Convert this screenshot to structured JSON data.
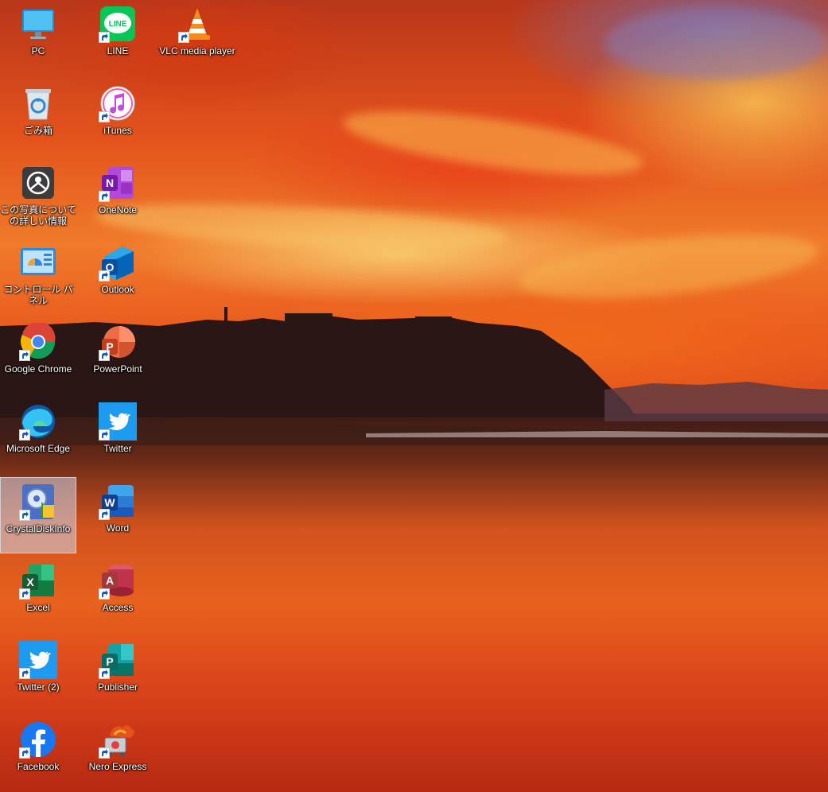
{
  "desktop": {
    "icons": [
      {
        "label": "PC",
        "icon": "monitor-icon",
        "name": "desktop-icon-pc",
        "shortcut": false
      },
      {
        "label": "LINE",
        "icon": "line-app-icon",
        "name": "desktop-icon-line",
        "shortcut": true
      },
      {
        "label": "VLC media player",
        "icon": "vlc-cone-icon",
        "name": "desktop-icon-vlc",
        "shortcut": true
      },
      {
        "label": "ごみ箱",
        "icon": "recycle-bin-icon",
        "name": "desktop-icon-recycle-bin",
        "shortcut": false
      },
      {
        "label": "iTunes",
        "icon": "itunes-icon",
        "name": "desktop-icon-itunes",
        "shortcut": true
      },
      {
        "label": "この写真について の詳しい情報",
        "icon": "photo-info-icon",
        "name": "desktop-icon-photo-info",
        "shortcut": false
      },
      {
        "label": "OneNote",
        "icon": "onenote-icon",
        "name": "desktop-icon-onenote",
        "shortcut": true
      },
      {
        "label": "コントロール パネル",
        "icon": "control-panel-icon",
        "name": "desktop-icon-control-panel",
        "shortcut": false
      },
      {
        "label": "Outlook",
        "icon": "outlook-icon",
        "name": "desktop-icon-outlook",
        "shortcut": true
      },
      {
        "label": "Google Chrome",
        "icon": "chrome-icon",
        "name": "desktop-icon-chrome",
        "shortcut": true
      },
      {
        "label": "PowerPoint",
        "icon": "powerpoint-icon",
        "name": "desktop-icon-powerpoint",
        "shortcut": true
      },
      {
        "label": "Microsoft Edge",
        "icon": "edge-icon",
        "name": "desktop-icon-edge",
        "shortcut": true
      },
      {
        "label": "Twitter",
        "icon": "twitter-icon",
        "name": "desktop-icon-twitter",
        "shortcut": true
      },
      {
        "label": "CrystalDiskInfo",
        "icon": "crystaldiskinfo-icon",
        "name": "desktop-icon-crystaldiskinfo",
        "shortcut": true,
        "selected": true
      },
      {
        "label": "Word",
        "icon": "word-icon",
        "name": "desktop-icon-word",
        "shortcut": true
      },
      {
        "label": "Excel",
        "icon": "excel-icon",
        "name": "desktop-icon-excel",
        "shortcut": true
      },
      {
        "label": "Access",
        "icon": "access-icon",
        "name": "desktop-icon-access",
        "shortcut": true
      },
      {
        "label": "Twitter (2)",
        "icon": "twitter-icon",
        "name": "desktop-icon-twitter-2",
        "shortcut": true
      },
      {
        "label": "Publisher",
        "icon": "publisher-icon",
        "name": "desktop-icon-publisher",
        "shortcut": true
      },
      {
        "label": "Facebook",
        "icon": "facebook-icon",
        "name": "desktop-icon-facebook",
        "shortcut": true
      },
      {
        "label": "Nero Express",
        "icon": "nero-express-icon",
        "name": "desktop-icon-nero-express",
        "shortcut": true
      }
    ]
  },
  "colors": {
    "selection": "#cfd6e4",
    "label_text": "#ffffff",
    "shortcut_arrow": "#1a5fb4"
  }
}
